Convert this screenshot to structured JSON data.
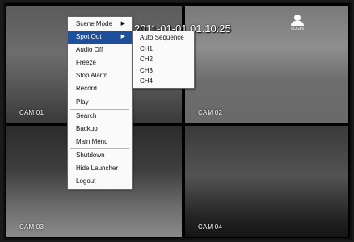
{
  "datetime": "2011-01-01 01:10:25",
  "user_label": "LOGIN",
  "cameras": [
    {
      "label": "CAM 01"
    },
    {
      "label": "CAM 02"
    },
    {
      "label": "CAM 03"
    },
    {
      "label": "CAM 04"
    }
  ],
  "context_menu": {
    "items": [
      {
        "label": "Scene Mode",
        "submenu_arrow": "▶"
      },
      {
        "label": "Spot Out",
        "submenu_arrow": "▶",
        "selected": true
      },
      {
        "label": "Audio Off"
      },
      {
        "label": "Freeze"
      },
      {
        "label": "Stop Alarm"
      },
      {
        "label": "Record"
      },
      {
        "label": "Play"
      },
      {
        "label": "Search"
      },
      {
        "label": "Backup"
      },
      {
        "label": "Main Menu"
      },
      {
        "label": "Shutdown"
      },
      {
        "label": "Hide Launcher"
      },
      {
        "label": "Logout"
      }
    ]
  },
  "spot_out_submenu": {
    "items": [
      {
        "label": "Auto Sequence"
      },
      {
        "label": "CH1"
      },
      {
        "label": "CH2"
      },
      {
        "label": "CH3"
      },
      {
        "label": "CH4"
      }
    ]
  },
  "colors": {
    "menu_highlight": "#1e4f9b",
    "menu_background": "#fafafa",
    "overlay_text": "#ffffff"
  }
}
